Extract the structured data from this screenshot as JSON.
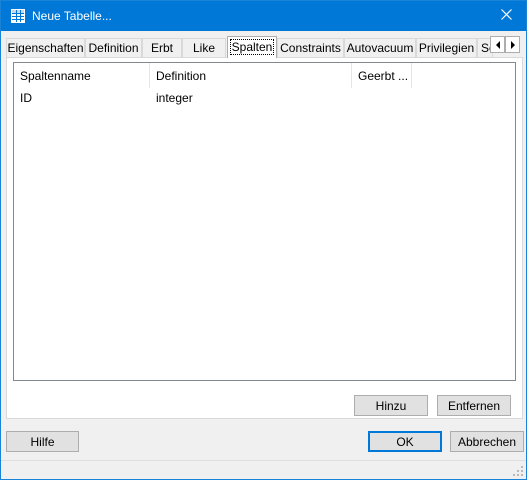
{
  "window": {
    "title": "Neue Tabelle...",
    "icon": "table-icon",
    "close_icon": "close-icon"
  },
  "tabs": [
    {
      "label": "Eigenschaften",
      "active": false
    },
    {
      "label": "Definition",
      "active": false
    },
    {
      "label": "Erbt",
      "active": false
    },
    {
      "label": "Like",
      "active": false
    },
    {
      "label": "Spalten",
      "active": true
    },
    {
      "label": "Constraints",
      "active": false
    },
    {
      "label": "Autovacuum",
      "active": false
    },
    {
      "label": "Privilegien",
      "active": false
    },
    {
      "label": "Se",
      "active": false
    }
  ],
  "tab_scroll": {
    "left_icon": "arrow-left-icon",
    "right_icon": "arrow-right-icon"
  },
  "columns_list": {
    "headers": [
      "Spaltenname",
      "Definition",
      "Geerbt ..."
    ],
    "rows": [
      {
        "name": "ID",
        "definition": "integer",
        "inherited": ""
      }
    ]
  },
  "buttons": {
    "add": "Hinzu",
    "remove": "Entfernen",
    "help": "Hilfe",
    "ok": "OK",
    "cancel": "Abbrechen"
  },
  "colors": {
    "titlebar": "#0078d7",
    "default_button_border": "#0078d7"
  }
}
